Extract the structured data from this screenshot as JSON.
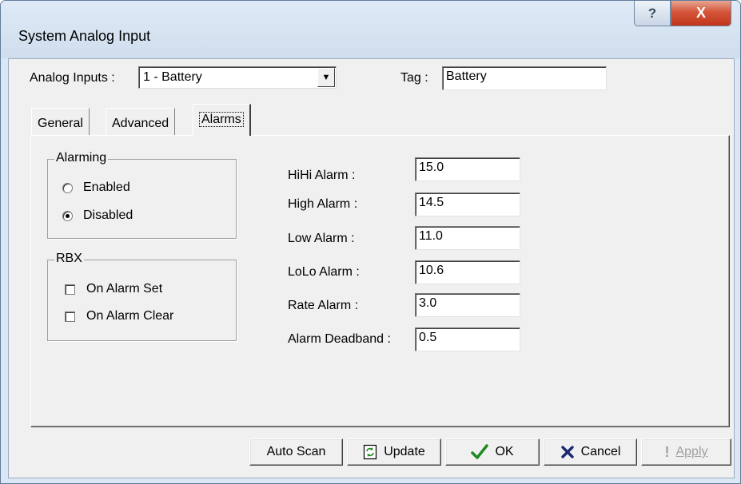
{
  "window": {
    "title": "System Analog Input",
    "help_glyph": "?",
    "close_glyph": "X"
  },
  "top": {
    "analog_inputs_label": "Analog Inputs :",
    "analog_inputs_value": "1 - Battery",
    "tag_label": "Tag :",
    "tag_value": "Battery"
  },
  "tabs": [
    {
      "label": "General"
    },
    {
      "label": "Advanced"
    },
    {
      "label": "Alarms",
      "active": true
    }
  ],
  "alarming": {
    "title": "Alarming",
    "options": [
      {
        "label": "Enabled",
        "selected": false
      },
      {
        "label": "Disabled",
        "selected": true
      }
    ]
  },
  "rbx": {
    "title": "RBX",
    "options": [
      {
        "label": "On Alarm Set",
        "checked": false
      },
      {
        "label": "On Alarm Clear",
        "checked": false
      }
    ]
  },
  "alarms": [
    {
      "label": "HiHi Alarm :",
      "value": "15.0"
    },
    {
      "label": "High Alarm :",
      "value": "14.5"
    },
    {
      "label": "Low Alarm :",
      "value": "11.0"
    },
    {
      "label": "LoLo Alarm :",
      "value": "10.6"
    },
    {
      "label": "Rate Alarm :",
      "value": "3.0"
    },
    {
      "label": "Alarm Deadband :",
      "value": "0.5"
    }
  ],
  "buttons": {
    "auto_scan": "Auto Scan",
    "update": "Update",
    "ok": "OK",
    "cancel": "Cancel",
    "apply": "Apply"
  },
  "colors": {
    "ok_check": "#1f8a1f",
    "cancel_x": "#1a2a6e",
    "close_button": "#c9462b"
  }
}
